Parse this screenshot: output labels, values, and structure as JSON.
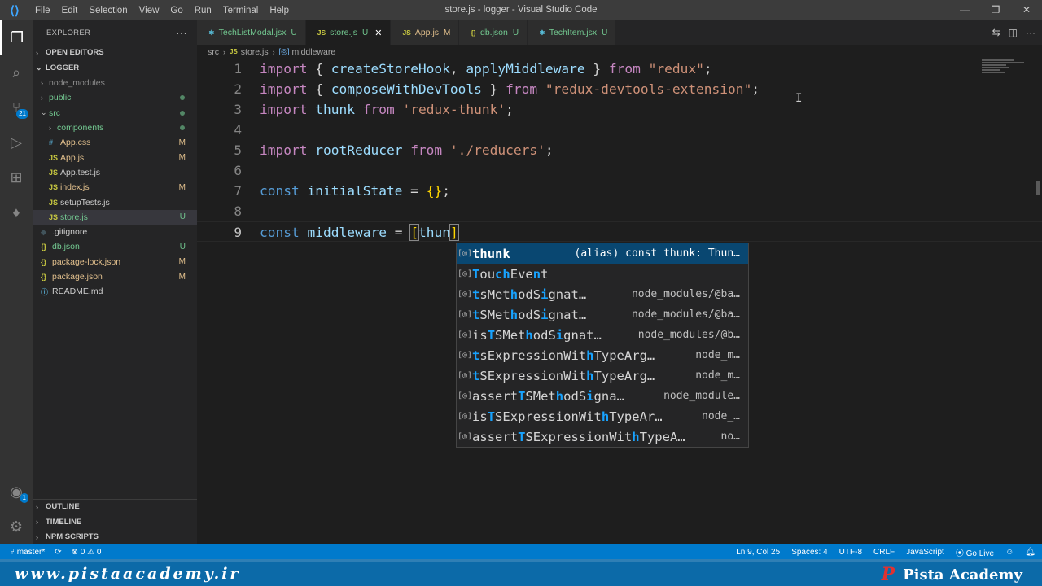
{
  "window": {
    "title": "store.js - logger - Visual Studio Code",
    "menu": [
      "File",
      "Edit",
      "Selection",
      "View",
      "Go",
      "Run",
      "Terminal",
      "Help"
    ],
    "controls": [
      "—",
      "❐",
      "✕"
    ]
  },
  "activity": {
    "scm_badge": "21",
    "accounts_badge": "1"
  },
  "sidebar": {
    "title": "EXPLORER",
    "more": "···",
    "open_editors": "OPEN EDITORS",
    "root": "LOGGER",
    "items": [
      {
        "label": "node_modules",
        "type": "folder",
        "open": false,
        "depth": 1,
        "color": "ignored",
        "status": ""
      },
      {
        "label": "public",
        "type": "folder",
        "open": false,
        "depth": 1,
        "color": "untracked",
        "status": "dot"
      },
      {
        "label": "src",
        "type": "folder",
        "open": true,
        "depth": 1,
        "color": "untracked",
        "status": "dot"
      },
      {
        "label": "components",
        "type": "folder",
        "open": false,
        "depth": 2,
        "color": "untracked",
        "status": "dot"
      },
      {
        "label": "App.css",
        "type": "css",
        "depth": 2,
        "color": "modified",
        "status": "M"
      },
      {
        "label": "App.js",
        "type": "js",
        "depth": 2,
        "color": "modified",
        "status": "M"
      },
      {
        "label": "App.test.js",
        "type": "js",
        "depth": 2,
        "color": "normal",
        "status": ""
      },
      {
        "label": "index.js",
        "type": "js",
        "depth": 2,
        "color": "modified",
        "status": "M"
      },
      {
        "label": "setupTests.js",
        "type": "js",
        "depth": 2,
        "color": "normal",
        "status": ""
      },
      {
        "label": "store.js",
        "type": "js",
        "depth": 2,
        "color": "untracked",
        "status": "U",
        "selected": true
      },
      {
        "label": ".gitignore",
        "type": "git",
        "depth": 1,
        "color": "normal",
        "status": ""
      },
      {
        "label": "db.json",
        "type": "json",
        "depth": 1,
        "color": "untracked",
        "status": "U"
      },
      {
        "label": "package-lock.json",
        "type": "json",
        "depth": 1,
        "color": "modified",
        "status": "M"
      },
      {
        "label": "package.json",
        "type": "json",
        "depth": 1,
        "color": "modified",
        "status": "M"
      },
      {
        "label": "README.md",
        "type": "info",
        "depth": 1,
        "color": "normal",
        "status": ""
      }
    ],
    "bottom_sections": [
      "OUTLINE",
      "TIMELINE",
      "NPM SCRIPTS"
    ]
  },
  "tabs": [
    {
      "label": "TechListModal.jsx",
      "icon": "react",
      "status": "U",
      "active": false,
      "color": "#73c991"
    },
    {
      "label": "store.js",
      "icon": "JS",
      "status": "U",
      "active": true,
      "color": "#73c991"
    },
    {
      "label": "App.js",
      "icon": "JS",
      "status": "M",
      "active": false,
      "color": "#e2c08d"
    },
    {
      "label": "db.json",
      "icon": "{}",
      "status": "U",
      "active": false,
      "color": "#73c991"
    },
    {
      "label": "TechItem.jsx",
      "icon": "react",
      "status": "U",
      "active": false,
      "color": "#73c991"
    }
  ],
  "breadcrumb": {
    "folder": "src",
    "file": "store.js",
    "symbol": "middleware"
  },
  "code_lines": [
    {
      "n": "1",
      "tokens": [
        [
          "k2",
          "import"
        ],
        [
          "p",
          " { "
        ],
        [
          "v",
          "createStoreHook"
        ],
        [
          "p",
          ", "
        ],
        [
          "v",
          "applyMiddleware"
        ],
        [
          "p",
          " } "
        ],
        [
          "k2",
          "from"
        ],
        [
          "p",
          " "
        ],
        [
          "s",
          "\"redux\""
        ],
        [
          "p",
          ";"
        ]
      ]
    },
    {
      "n": "2",
      "tokens": [
        [
          "k2",
          "import"
        ],
        [
          "p",
          " { "
        ],
        [
          "v",
          "composeWithDevTools"
        ],
        [
          "p",
          " } "
        ],
        [
          "k2",
          "from"
        ],
        [
          "p",
          " "
        ],
        [
          "s",
          "\"redux-devtools-extension\""
        ],
        [
          "p",
          ";"
        ]
      ]
    },
    {
      "n": "3",
      "tokens": [
        [
          "k2",
          "import"
        ],
        [
          "p",
          " "
        ],
        [
          "v",
          "thunk"
        ],
        [
          "p",
          " "
        ],
        [
          "k2",
          "from"
        ],
        [
          "p",
          " "
        ],
        [
          "s",
          "'redux-thunk'"
        ],
        [
          "p",
          ";"
        ]
      ]
    },
    {
      "n": "4",
      "tokens": []
    },
    {
      "n": "5",
      "tokens": [
        [
          "k2",
          "import"
        ],
        [
          "p",
          " "
        ],
        [
          "v",
          "rootReducer"
        ],
        [
          "p",
          " "
        ],
        [
          "k2",
          "from"
        ],
        [
          "p",
          " "
        ],
        [
          "s",
          "'./reducers'"
        ],
        [
          "p",
          ";"
        ]
      ]
    },
    {
      "n": "6",
      "tokens": []
    },
    {
      "n": "7",
      "tokens": [
        [
          "k",
          "const"
        ],
        [
          "p",
          " "
        ],
        [
          "v",
          "initialState"
        ],
        [
          "p",
          " = "
        ],
        [
          "br",
          "{}"
        ],
        [
          "p",
          ";"
        ]
      ]
    },
    {
      "n": "8",
      "tokens": []
    },
    {
      "n": "9",
      "tokens": [
        [
          "k",
          "const"
        ],
        [
          "p",
          " "
        ],
        [
          "v",
          "middleware"
        ],
        [
          "p",
          " = "
        ],
        [
          "brm",
          "["
        ],
        [
          "v",
          "thun"
        ],
        [
          "brm",
          "]"
        ]
      ],
      "current": true
    }
  ],
  "suggestions": [
    {
      "label": "thunk",
      "match": [
        0,
        1,
        2,
        3,
        4
      ],
      "detail": "(alias) const thunk: Thun…",
      "selected": true
    },
    {
      "label": "TouchEvent",
      "match": [
        0,
        3,
        4,
        8
      ],
      "detail": ""
    },
    {
      "label": "tsMethodSignat…",
      "match": [
        0,
        5,
        9
      ],
      "detail": "node_modules/@ba…"
    },
    {
      "label": "tSMethodSignat…",
      "match": [
        0,
        5,
        9
      ],
      "detail": "node_modules/@ba…"
    },
    {
      "label": "isTSMethodSignat…",
      "match": [
        2,
        7,
        11
      ],
      "detail": "node_modules/@b…"
    },
    {
      "label": "tsExpressionWithTypeArg…",
      "match": [
        0,
        15
      ],
      "detail": "node_m…"
    },
    {
      "label": "tSExpressionWithTypeArg…",
      "match": [
        0,
        15
      ],
      "detail": "node_m…"
    },
    {
      "label": "assertTSMethodSigna…",
      "match": [
        6,
        11,
        15
      ],
      "detail": "node_module…"
    },
    {
      "label": "isTSExpressionWithTypeAr…",
      "match": [
        2,
        17
      ],
      "detail": "node_…"
    },
    {
      "label": "assertTSExpressionWithTypeA…",
      "match": [
        6,
        21
      ],
      "detail": "no…"
    }
  ],
  "statusbar": {
    "branch": "master*",
    "sync": "⟳",
    "errors": "⊗ 0 ⚠ 0",
    "position": "Ln 9, Col 25",
    "spaces": "Spaces: 4",
    "encoding": "UTF-8",
    "eol": "CRLF",
    "language": "JavaScript",
    "golive": "Go Live"
  },
  "footer": {
    "url": "www.pistaacademy.ir",
    "brand": "Pista Academy",
    "logo_letter": "P"
  },
  "colors": {
    "accent": "#007acc",
    "untracked": "#73c991",
    "modified": "#e2c08d",
    "suggest_selected": "#094771"
  }
}
